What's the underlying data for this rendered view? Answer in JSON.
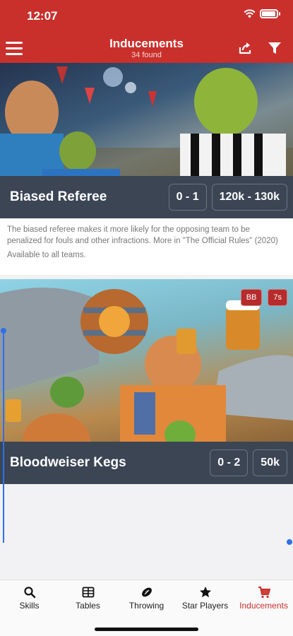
{
  "status": {
    "time": "12:07"
  },
  "header": {
    "title": "Inducements",
    "subtitle": "34 found"
  },
  "cards": [
    {
      "title": "Biased Referee",
      "range": "0 - 1",
      "cost": "120k - 130k",
      "description": "The biased referee makes it more likely for the opposing team to be penalized for fouls and other infractions. More in \"The Official Rules\" (2020)",
      "availability": "Available to all teams."
    },
    {
      "title": "Bloodweiser Kegs",
      "range": "0 - 2",
      "cost": "50k",
      "badges": [
        "BB",
        "7s"
      ]
    }
  ],
  "tabs": [
    {
      "label": "Skills",
      "icon": "search-icon"
    },
    {
      "label": "Tables",
      "icon": "table-icon"
    },
    {
      "label": "Throwing",
      "icon": "football-icon"
    },
    {
      "label": "Star Players",
      "icon": "star-icon"
    },
    {
      "label": "Inducements",
      "icon": "cart-icon",
      "active": true
    }
  ],
  "colors": {
    "accent": "#c9302c",
    "bar": "#3c4554",
    "selection": "#2f6fea"
  }
}
